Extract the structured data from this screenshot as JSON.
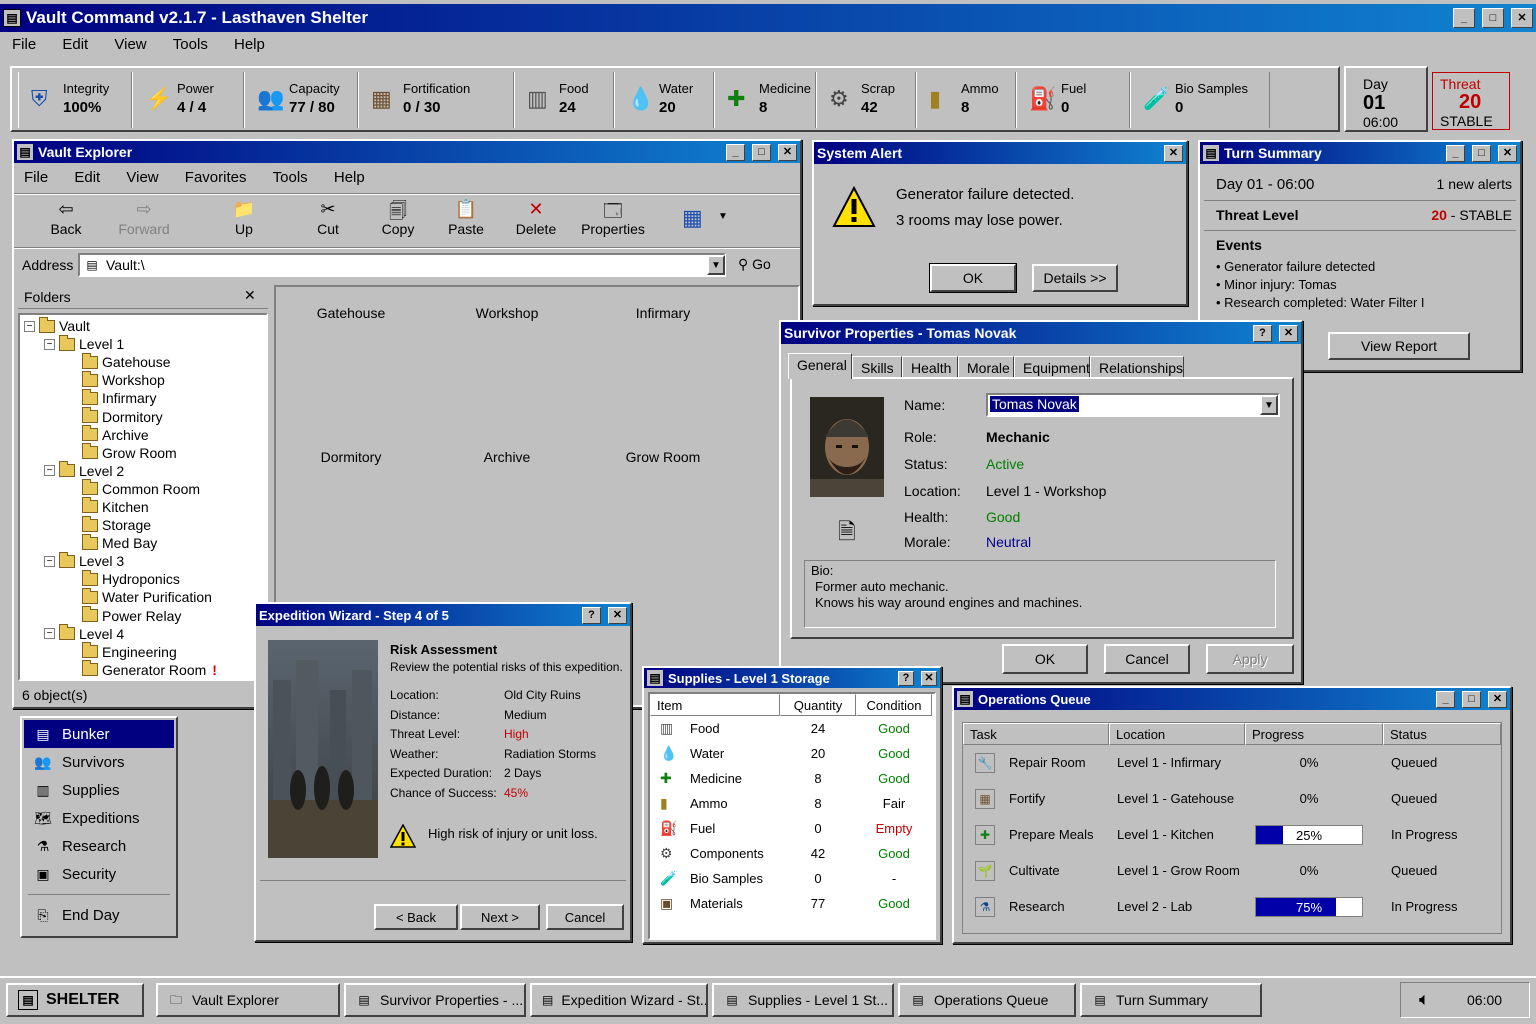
{
  "app": {
    "title": "Vault Command v2.1.7 - Lasthaven Shelter",
    "menu": [
      "File",
      "Edit",
      "View",
      "Tools",
      "Help"
    ]
  },
  "stats": [
    {
      "label": "Integrity",
      "value": "100%",
      "icon": "shield-icon"
    },
    {
      "label": "Power",
      "value": "4 / 4",
      "icon": "lightning-icon"
    },
    {
      "label": "Capacity",
      "value": "77 / 80",
      "icon": "people-icon"
    },
    {
      "label": "Fortification",
      "value": "0 / 30",
      "icon": "wall-icon"
    },
    {
      "label": "Food",
      "value": "24",
      "icon": "can-icon"
    },
    {
      "label": "Water",
      "value": "20",
      "icon": "water-drop-icon"
    },
    {
      "label": "Medicine",
      "value": "8",
      "icon": "medical-cross-icon"
    },
    {
      "label": "Scrap",
      "value": "42",
      "icon": "gear-icon"
    },
    {
      "label": "Ammo",
      "value": "8",
      "icon": "bullet-icon"
    },
    {
      "label": "Fuel",
      "value": "0",
      "icon": "fuel-can-icon"
    },
    {
      "label": "Bio Samples",
      "value": "0",
      "icon": "test-tube-icon"
    }
  ],
  "day": {
    "label": "Day",
    "value": "01",
    "time": "06:00"
  },
  "threat": {
    "label": "Threat",
    "value": "20",
    "status": "STABLE"
  },
  "explorer": {
    "title": "Vault Explorer",
    "menu": [
      "File",
      "Edit",
      "View",
      "Favorites",
      "Tools",
      "Help"
    ],
    "toolbar": [
      "Back",
      "Forward",
      "Up",
      "Cut",
      "Copy",
      "Paste",
      "Delete",
      "Properties"
    ],
    "address_label": "Address",
    "address": "Vault:\\",
    "go": "Go",
    "folders_label": "Folders",
    "tree": [
      {
        "label": "Vault",
        "level": 0,
        "type": "root"
      },
      {
        "label": "Level 1",
        "level": 1,
        "type": "level"
      },
      {
        "label": "Gatehouse",
        "level": 2,
        "type": "room"
      },
      {
        "label": "Workshop",
        "level": 2,
        "type": "room"
      },
      {
        "label": "Infirmary",
        "level": 2,
        "type": "room"
      },
      {
        "label": "Dormitory",
        "level": 2,
        "type": "room"
      },
      {
        "label": "Archive",
        "level": 2,
        "type": "room"
      },
      {
        "label": "Grow Room",
        "level": 2,
        "type": "room"
      },
      {
        "label": "Level 2",
        "level": 1,
        "type": "level"
      },
      {
        "label": "Common Room",
        "level": 2,
        "type": "room"
      },
      {
        "label": "Kitchen",
        "level": 2,
        "type": "room"
      },
      {
        "label": "Storage",
        "level": 2,
        "type": "room"
      },
      {
        "label": "Med Bay",
        "level": 2,
        "type": "room"
      },
      {
        "label": "Level 3",
        "level": 1,
        "type": "level"
      },
      {
        "label": "Hydroponics",
        "level": 2,
        "type": "room"
      },
      {
        "label": "Water Purification",
        "level": 2,
        "type": "room"
      },
      {
        "label": "Power Relay",
        "level": 2,
        "type": "room"
      },
      {
        "label": "Level 4",
        "level": 1,
        "type": "level"
      },
      {
        "label": "Engineering",
        "level": 2,
        "type": "room"
      },
      {
        "label": "Generator Room",
        "level": 2,
        "type": "room",
        "alert": "!"
      }
    ],
    "rooms": [
      "Gatehouse",
      "Workshop",
      "Infirmary",
      "Dormitory",
      "Archive",
      "Grow Room"
    ],
    "status": "6 object(s)"
  },
  "nav": [
    "Bunker",
    "Survivors",
    "Supplies",
    "Expeditions",
    "Research",
    "Security",
    "End Day"
  ],
  "alert": {
    "title": "System Alert",
    "line1": "Generator failure detected.",
    "line2": "3 rooms may lose power.",
    "ok": "OK",
    "details": "Details >>"
  },
  "turn": {
    "title": "Turn Summary",
    "day": "Day 01 - 06:00",
    "alerts": "1 new alerts",
    "threat_label": "Threat Level",
    "threat_value": "20",
    "threat_status": " - STABLE",
    "events_label": "Events",
    "events": [
      "Generator failure detected",
      "Minor injury: Tomas",
      "Research completed: Water Filter I"
    ],
    "button": "View Report"
  },
  "survivor": {
    "title": "Survivor Properties - Tomas Novak",
    "tabs": [
      "General",
      "Skills",
      "Health",
      "Morale",
      "Equipment",
      "Relationships"
    ],
    "fields": {
      "name_label": "Name:",
      "name": "Tomas Novak",
      "role_label": "Role:",
      "role": "Mechanic",
      "status_label": "Status:",
      "status": "Active",
      "location_label": "Location:",
      "location": "Level 1 - Workshop",
      "health_label": "Health:",
      "health": "Good",
      "morale_label": "Morale:",
      "morale": "Neutral"
    },
    "bio_label": "Bio:",
    "bio1": "Former auto mechanic.",
    "bio2": "Knows his way around engines and machines.",
    "ok": "OK",
    "cancel": "Cancel",
    "apply": "Apply"
  },
  "wizard": {
    "title": "Expedition Wizard - Step 4 of 5",
    "heading": "Risk Assessment",
    "desc": "Review the potential risks of this expedition.",
    "rows": [
      {
        "label": "Location:",
        "value": "Old City Ruins",
        "color": "normal"
      },
      {
        "label": "Distance:",
        "value": "Medium",
        "color": "normal"
      },
      {
        "label": "Threat Level:",
        "value": "High",
        "color": "red"
      },
      {
        "label": "Weather:",
        "value": "Radiation Storms",
        "color": "normal"
      },
      {
        "label": "Expected Duration:",
        "value": "2 Days",
        "color": "normal"
      },
      {
        "label": "Chance of Success:",
        "value": "45%",
        "color": "red"
      }
    ],
    "warning": "High risk of injury or unit loss.",
    "back": "< Back",
    "next": "Next >",
    "cancel": "Cancel"
  },
  "supplies": {
    "title": "Supplies - Level 1 Storage",
    "columns": [
      "Item",
      "Quantity",
      "Condition"
    ],
    "rows": [
      {
        "item": "Food",
        "qty": "24",
        "cond": "Good",
        "icon": "can-icon",
        "color": "green"
      },
      {
        "item": "Water",
        "qty": "20",
        "cond": "Good",
        "icon": "water-drop-icon",
        "color": "green"
      },
      {
        "item": "Medicine",
        "qty": "8",
        "cond": "Good",
        "icon": "medical-cross-icon",
        "color": "green"
      },
      {
        "item": "Ammo",
        "qty": "8",
        "cond": "Fair",
        "icon": "bullet-icon",
        "color": "normal"
      },
      {
        "item": "Fuel",
        "qty": "0",
        "cond": "Empty",
        "icon": "fuel-can-icon",
        "color": "red"
      },
      {
        "item": "Components",
        "qty": "42",
        "cond": "Good",
        "icon": "gear-icon",
        "color": "green"
      },
      {
        "item": "Bio Samples",
        "qty": "0",
        "cond": "-",
        "icon": "test-tube-icon",
        "color": "normal"
      },
      {
        "item": "Materials",
        "qty": "77",
        "cond": "Good",
        "icon": "crate-icon",
        "color": "green"
      }
    ]
  },
  "ops": {
    "title": "Operations Queue",
    "columns": [
      "Task",
      "Location",
      "Progress",
      "Status"
    ],
    "rows": [
      {
        "task": "Repair Room",
        "loc": "Level 1 - Infirmary",
        "progress": 0,
        "ptext": "0%",
        "status": "Queued",
        "icon": "wrench-icon"
      },
      {
        "task": "Fortify",
        "loc": "Level 1 - Gatehouse",
        "progress": 0,
        "ptext": "0%",
        "status": "Queued",
        "icon": "wall-icon"
      },
      {
        "task": "Prepare Meals",
        "loc": "Level 1 - Kitchen",
        "progress": 25,
        "ptext": "25%",
        "status": "In Progress",
        "icon": "medical-cross-icon"
      },
      {
        "task": "Cultivate",
        "loc": "Level 1 - Grow Room",
        "progress": 0,
        "ptext": "0%",
        "status": "Queued",
        "icon": "plant-icon"
      },
      {
        "task": "Research",
        "loc": "Level 2 - Lab",
        "progress": 75,
        "ptext": "75%",
        "status": "In Progress",
        "icon": "research-icon"
      }
    ]
  },
  "taskbar": {
    "start": "SHELTER",
    "items": [
      "Vault Explorer",
      "Survivor Properties - ...",
      "Expedition Wizard - St...",
      "Supplies - Level 1 St...",
      "Operations Queue",
      "Turn Summary"
    ],
    "clock": "06:00"
  },
  "colors": {
    "titlebar": "#000080",
    "accent_red": "#c00000",
    "good": "#008000"
  }
}
